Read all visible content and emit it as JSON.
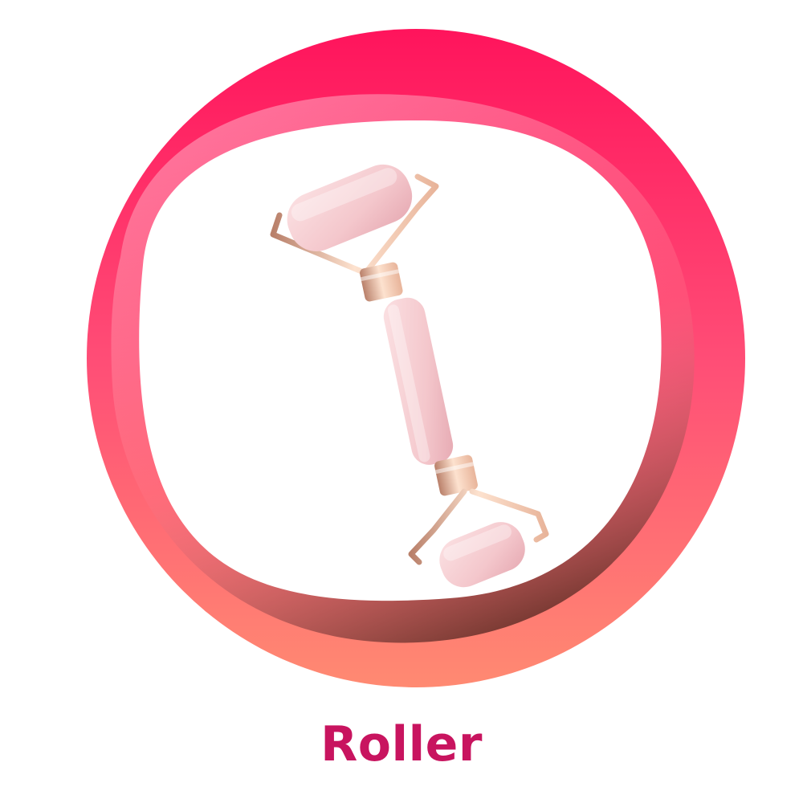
{
  "caption": {
    "text": "Roller"
  },
  "colors": {
    "caption": "#c8145f",
    "ring_top": "#ff145c",
    "ring_mid": "#ff4d76",
    "ring_bottom": "#ff8a72",
    "inner_shadow": "#5a2a22",
    "stone": "#f4c7cc",
    "stone_shade": "#e6a9b2",
    "metal": "#e8b49a",
    "metal_dark": "#b9806a"
  },
  "icons": {
    "ring": "gradient-ring-frame",
    "product": "face-roller-icon"
  }
}
